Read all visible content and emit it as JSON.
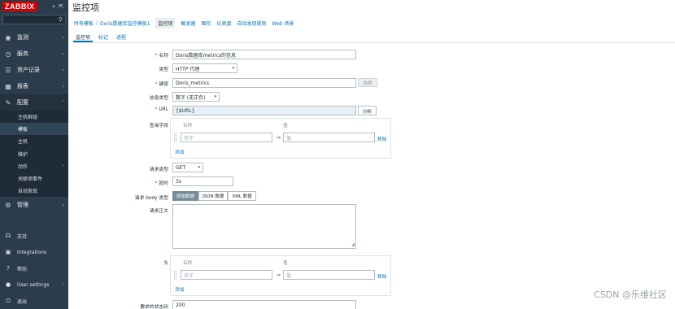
{
  "sidebar": {
    "logo": "ZABBIX",
    "search_value": "",
    "menu": [
      {
        "label": "监测",
        "icon": "eye-icon"
      },
      {
        "label": "服务",
        "icon": "clock-icon"
      },
      {
        "label": "资产记录",
        "icon": "list-icon"
      },
      {
        "label": "报表",
        "icon": "chart-icon"
      },
      {
        "label": "配置",
        "icon": "wrench-icon"
      }
    ],
    "submenu": [
      "主机群组",
      "模板",
      "主机",
      "维护",
      "动作",
      "关联项事件",
      "自动发现"
    ],
    "admin": "管理",
    "bottom": [
      "支持",
      "Integrations",
      "帮助",
      "User settings",
      "退出"
    ]
  },
  "page": {
    "title": "监控项",
    "breadcrumb": [
      "所有模板",
      "Doris数据库监控模板1",
      "监控项",
      "触发器",
      "图形",
      "仪表盘",
      "自动发现规则",
      "Web 场景"
    ],
    "tabs": [
      "监控项",
      "标记",
      "进程"
    ]
  },
  "form": {
    "name_label": "名称",
    "name_value": "Doris数据库metrics的信息",
    "type_label": "类型",
    "type_value": "HTTP 代理",
    "key_label": "键值",
    "key_value": "Doris_metrics",
    "select_button": "选择",
    "info_type_label": "信息类型",
    "info_type_value": "数字 (无正负)",
    "url_label": "URL",
    "url_value": "{$URL}",
    "parse_button": "分析",
    "query_fields_label": "查询字段",
    "col_name": "名称",
    "col_value": "值",
    "name_placeholder": "名字",
    "value_placeholder": "值",
    "remove_link": "移除",
    "add_link": "添加",
    "request_type_label": "请求类型",
    "request_type_value": "GET",
    "timeout_label": "超时",
    "timeout_value": "3s",
    "body_type_label": "请求 body 类型",
    "body_types": [
      "原始数据",
      "JSON 数据",
      "XML 数据"
    ],
    "body_label": "请求正文",
    "headers_label": "头",
    "status_label": "要求的状态码",
    "status_value": "200"
  },
  "watermark": "CSDN @乐维社区"
}
